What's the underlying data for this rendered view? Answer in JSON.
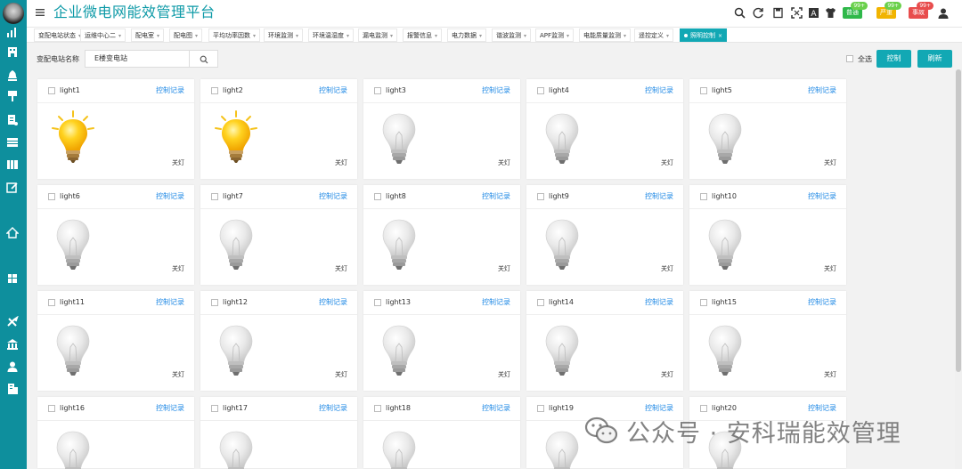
{
  "app": {
    "title": "企业微电网能效管理平台"
  },
  "colors": {
    "brand": "#0e8f9d",
    "accent": "#12a8b4",
    "link": "#1e88e5",
    "badge_green": "#2fb84a",
    "badge_yellow": "#f1b400",
    "badge_red": "#e84d4d"
  },
  "header": {
    "icons": [
      "search-icon",
      "refresh-icon",
      "save-icon",
      "fullscreen-icon",
      "font-icon",
      "shirt-icon"
    ],
    "badges": [
      {
        "label": "普通",
        "count": "99+"
      },
      {
        "label": "严重",
        "count": "99+"
      },
      {
        "label": "事故",
        "count": "99+"
      }
    ],
    "user_icon": "user-icon"
  },
  "sidebar": {
    "icons": [
      "chart-icon",
      "building-icon",
      "alarm-icon",
      "flag-icon",
      "document-icon",
      "table-icon",
      "grid-icon",
      "edit-icon",
      "home-icon",
      "layout-icon",
      "tools-icon",
      "bank-icon",
      "person-icon",
      "report-icon"
    ]
  },
  "tabs": [
    {
      "label": "变配电站状态"
    },
    {
      "label": "运维中心二"
    },
    {
      "label": "配电室"
    },
    {
      "label": "配电图"
    },
    {
      "label": "平均功率因数"
    },
    {
      "label": "环境监测"
    },
    {
      "label": "环境温湿度"
    },
    {
      "label": "漏电监测"
    },
    {
      "label": "报警信息"
    },
    {
      "label": "电力数据"
    },
    {
      "label": "谐波监测"
    },
    {
      "label": "APF监测"
    },
    {
      "label": "电能质量监测"
    },
    {
      "label": "遥控定义"
    },
    {
      "label": "照明控制",
      "active": true
    }
  ],
  "filter": {
    "label": "变配电站名称",
    "value": "E楼变电站",
    "select_all": "全选",
    "control_button": "控制",
    "refresh_button": "刷新"
  },
  "lights": [
    {
      "name": "light1",
      "record": "控制记录",
      "status": "关灯",
      "on": true
    },
    {
      "name": "light2",
      "record": "控制记录",
      "status": "关灯",
      "on": true
    },
    {
      "name": "light3",
      "record": "控制记录",
      "status": "关灯",
      "on": false
    },
    {
      "name": "light4",
      "record": "控制记录",
      "status": "关灯",
      "on": false
    },
    {
      "name": "light5",
      "record": "控制记录",
      "status": "关灯",
      "on": false
    },
    {
      "name": "light6",
      "record": "控制记录",
      "status": "关灯",
      "on": false
    },
    {
      "name": "light7",
      "record": "控制记录",
      "status": "关灯",
      "on": false
    },
    {
      "name": "light8",
      "record": "控制记录",
      "status": "关灯",
      "on": false
    },
    {
      "name": "light9",
      "record": "控制记录",
      "status": "关灯",
      "on": false
    },
    {
      "name": "light10",
      "record": "控制记录",
      "status": "关灯",
      "on": false
    },
    {
      "name": "light11",
      "record": "控制记录",
      "status": "关灯",
      "on": false
    },
    {
      "name": "light12",
      "record": "控制记录",
      "status": "关灯",
      "on": false
    },
    {
      "name": "light13",
      "record": "控制记录",
      "status": "关灯",
      "on": false
    },
    {
      "name": "light14",
      "record": "控制记录",
      "status": "关灯",
      "on": false
    },
    {
      "name": "light15",
      "record": "控制记录",
      "status": "关灯",
      "on": false
    },
    {
      "name": "light16",
      "record": "控制记录",
      "status": "",
      "on": false
    },
    {
      "name": "light17",
      "record": "控制记录",
      "status": "",
      "on": false
    },
    {
      "name": "light18",
      "record": "控制记录",
      "status": "",
      "on": false
    },
    {
      "name": "light19",
      "record": "控制记录",
      "status": "",
      "on": false
    },
    {
      "name": "light20",
      "record": "控制记录",
      "status": "",
      "on": false
    }
  ],
  "watermark": {
    "text": "公众号 · 安科瑞能效管理"
  }
}
